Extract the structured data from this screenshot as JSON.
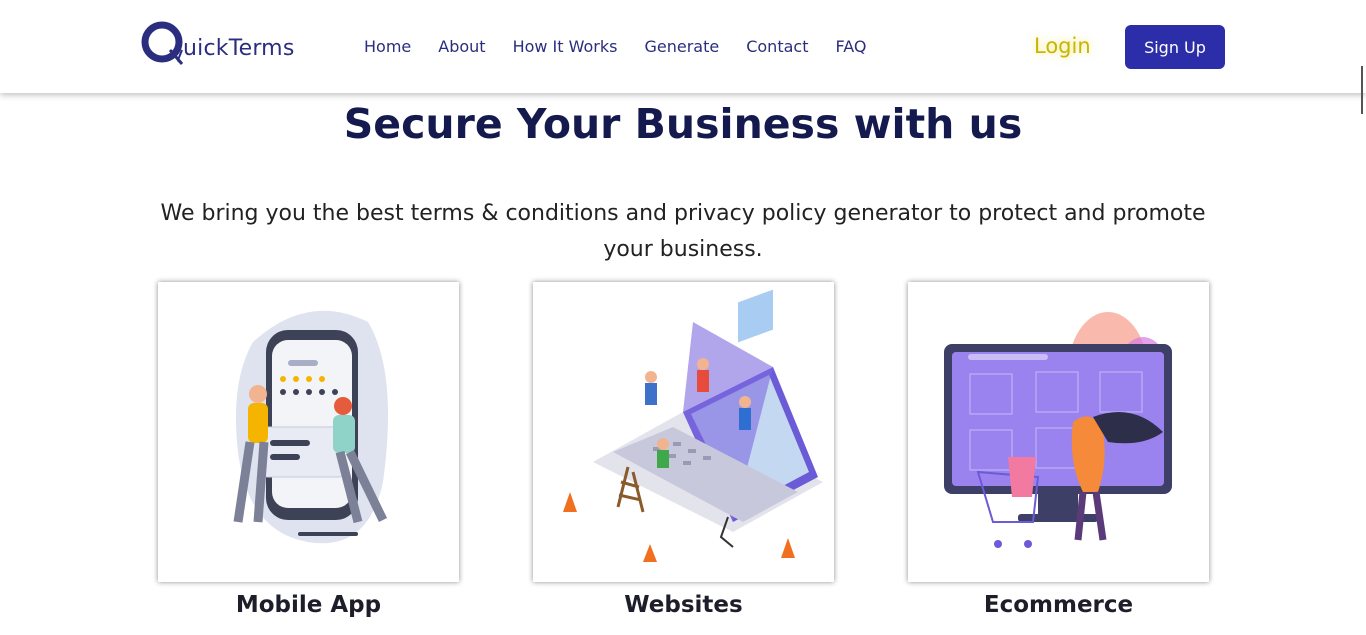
{
  "header": {
    "logo_text": "uickTerms",
    "nav": [
      "Home",
      "About",
      "How It Works",
      "Generate",
      "Contact",
      "FAQ"
    ],
    "login_label": "Login",
    "signup_label": "Sign Up"
  },
  "hero": {
    "title": "Secure Your Business with us",
    "subtitle": "We bring you the best terms & conditions and privacy policy generator to protect and promote your business."
  },
  "cards": [
    {
      "label": "Mobile App",
      "illustration": "mobile-app-illustration"
    },
    {
      "label": "Websites",
      "illustration": "websites-illustration"
    },
    {
      "label": "Ecommerce",
      "illustration": "ecommerce-illustration"
    }
  ],
  "colors": {
    "brand": "#2b2e7f",
    "signup_bg": "#2b2ea8",
    "login": "#c8b600",
    "title": "#141a4e"
  }
}
